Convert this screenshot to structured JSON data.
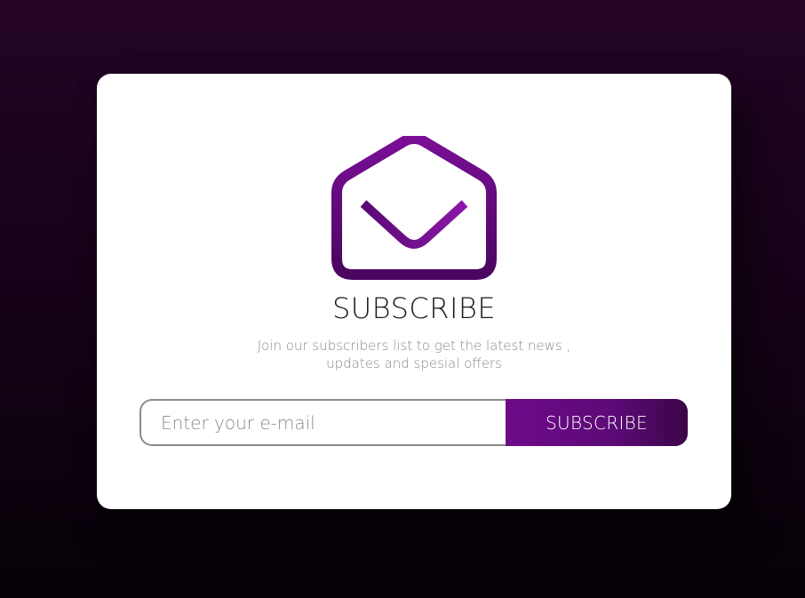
{
  "colors": {
    "background_top": "#240426",
    "background_bottom": "#050106",
    "card": "#ffffff",
    "accent": "#6e0a8a",
    "accent_dark": "#3b0548",
    "title_text": "#1a1a1a",
    "subtitle_text": "#8a8a8a"
  },
  "icon": {
    "name": "open-envelope-icon"
  },
  "card": {
    "title": "SUBSCRIBE",
    "subtitle_line1": "Join our subscribers list to get the latest news ,",
    "subtitle_line2": "updates and spesial offers"
  },
  "form": {
    "email_placeholder": "Enter your e-mail",
    "email_value": "",
    "button_label": "SUBSCRIBE"
  }
}
